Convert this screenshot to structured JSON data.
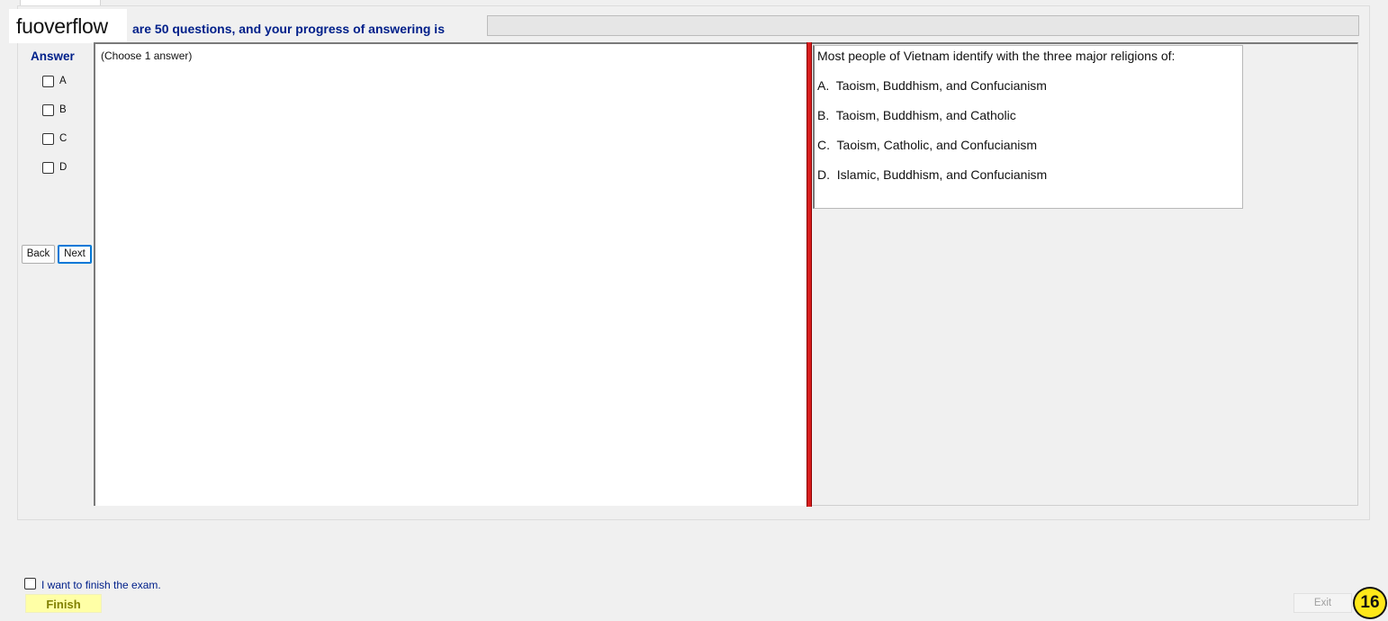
{
  "logo": {
    "text": "fuoverflow"
  },
  "progress": {
    "label": "are 50 questions, and your progress of answering is",
    "percent": 0,
    "fill_color": "#06b025"
  },
  "answer_panel": {
    "heading": "Answer",
    "options": [
      {
        "label": "A",
        "checked": false
      },
      {
        "label": "B",
        "checked": false
      },
      {
        "label": "C",
        "checked": false
      },
      {
        "label": "D",
        "checked": false
      }
    ],
    "back_label": "Back",
    "next_label": "Next",
    "instruction": "(Choose 1 answer)"
  },
  "question": {
    "text": "Most people of Vietnam identify with the three major religions of:",
    "options": [
      "A.  Taoism, Buddhism, and Confucianism",
      "B.  Taoism, Buddhism, and Catholic",
      "C.  Taoism, Catholic, and Confucianism",
      "D.  Islamic, Buddhism, and Confucianism"
    ]
  },
  "footer": {
    "finish_checkbox_label": "I want to finish the exam.",
    "finish_label": "Finish",
    "exit_label": "Exit",
    "badge": "16"
  },
  "colors": {
    "accent_text": "#00208a",
    "splitter": "#d91e1e",
    "finish_bg": "#ffffa6",
    "badge_bg": "#ffe81a"
  }
}
